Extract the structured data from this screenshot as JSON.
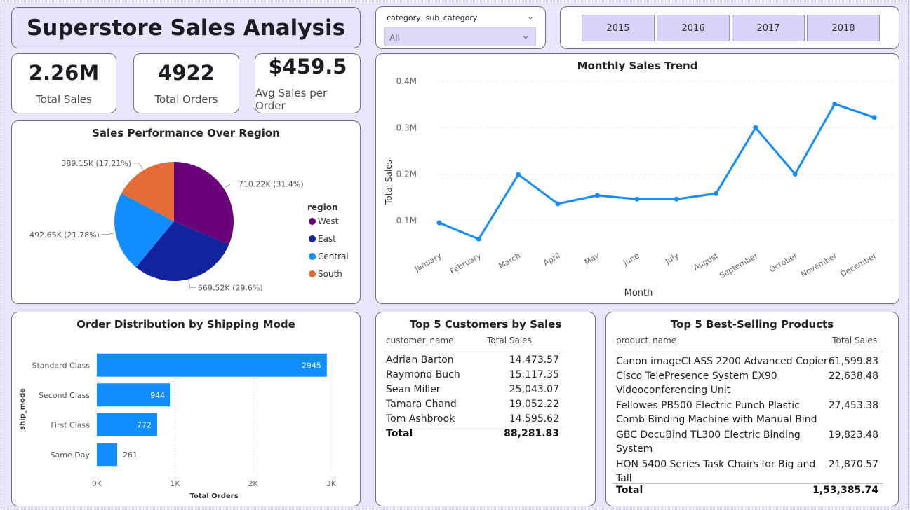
{
  "header": {
    "title": "Superstore Sales Analysis"
  },
  "kpis": [
    {
      "value": "2.26M",
      "label": "Total Sales"
    },
    {
      "value": "4922",
      "label": "Total Orders"
    },
    {
      "value": "$459.5",
      "label": "Avg Sales per Order"
    }
  ],
  "slicer": {
    "header": "category, sub_category",
    "selected": "All"
  },
  "years": [
    "2015",
    "2016",
    "2017",
    "2018"
  ],
  "colors": {
    "accent": "#118dff",
    "west": "#6b007b",
    "east": "#12239e",
    "central": "#118dff",
    "south": "#e66c37",
    "background": "#e9e6fb"
  },
  "icons": {
    "dropdown": "chevron-down-icon"
  },
  "chart_data": [
    {
      "id": "region",
      "type": "pie",
      "title": "Sales Performance Over Region",
      "legend_title": "region",
      "legend_position": "right",
      "slices": [
        {
          "name": "West",
          "value": 710.22,
          "label": "710.22K (31.4%)",
          "color": "#6b007b"
        },
        {
          "name": "East",
          "value": 669.52,
          "label": "669.52K (29.6%)",
          "color": "#12239e"
        },
        {
          "name": "Central",
          "value": 492.65,
          "label": "492.65K (21.78%)",
          "color": "#118dff"
        },
        {
          "name": "South",
          "value": 389.15,
          "label": "389.15K (17.21%)",
          "color": "#e66c37"
        }
      ]
    },
    {
      "id": "monthly",
      "type": "line",
      "title": "Monthly Sales Trend",
      "xlabel": "Month",
      "ylabel": "Total Sales",
      "ylim": [
        0,
        0.4
      ],
      "y_ticks": [
        0.1,
        0.2,
        0.3,
        0.4
      ],
      "y_tick_labels": [
        "0.1M",
        "0.2M",
        "0.3M",
        "0.4M"
      ],
      "grid": true,
      "categories": [
        "January",
        "February",
        "March",
        "April",
        "May",
        "June",
        "July",
        "August",
        "September",
        "October",
        "November",
        "December"
      ],
      "values": [
        0.095,
        0.06,
        0.199,
        0.136,
        0.154,
        0.146,
        0.146,
        0.158,
        0.3,
        0.2,
        0.351,
        0.322
      ]
    },
    {
      "id": "shipping",
      "type": "bar",
      "orientation": "horizontal",
      "title": "Order Distribution by Shipping Mode",
      "xlabel": "Total Orders",
      "ylabel": "ship_mode",
      "xlim": [
        0,
        3000
      ],
      "x_ticks": [
        0,
        1000,
        2000,
        3000
      ],
      "x_tick_labels": [
        "0K",
        "1K",
        "2K",
        "3K"
      ],
      "categories": [
        "Standard Class",
        "Second Class",
        "First Class",
        "Same Day"
      ],
      "values": [
        2945,
        944,
        772,
        261
      ]
    }
  ],
  "customers_table": {
    "title": "Top 5 Customers by Sales",
    "columns": [
      "customer_name",
      "Total Sales"
    ],
    "rows": [
      [
        "Adrian Barton",
        "14,473.57"
      ],
      [
        "Raymond Buch",
        "15,117.35"
      ],
      [
        "Sean Miller",
        "25,043.07"
      ],
      [
        "Tamara Chand",
        "19,052.22"
      ],
      [
        "Tom Ashbrook",
        "14,595.62"
      ]
    ],
    "total_label": "Total",
    "total_value": "88,281.83"
  },
  "products_table": {
    "title": "Top 5 Best-Selling Products",
    "columns": [
      "product_name",
      "Total Sales"
    ],
    "rows": [
      {
        "lines": [
          "Canon imageCLASS 2200 Advanced Copier"
        ],
        "value": "61,599.83"
      },
      {
        "lines": [
          "Cisco TelePresence System EX90",
          "Videoconferencing Unit"
        ],
        "value": "22,638.48"
      },
      {
        "lines": [
          "Fellowes PB500 Electric Punch Plastic",
          "Comb Binding Machine with Manual Bind"
        ],
        "value": "27,453.38"
      },
      {
        "lines": [
          "GBC DocuBind TL300 Electric Binding",
          "System"
        ],
        "value": "19,823.48"
      },
      {
        "lines": [
          "HON 5400 Series Task Chairs for Big and",
          "Tall"
        ],
        "value": "21,870.57"
      }
    ],
    "total_label": "Total",
    "total_value": "1,53,385.74"
  }
}
